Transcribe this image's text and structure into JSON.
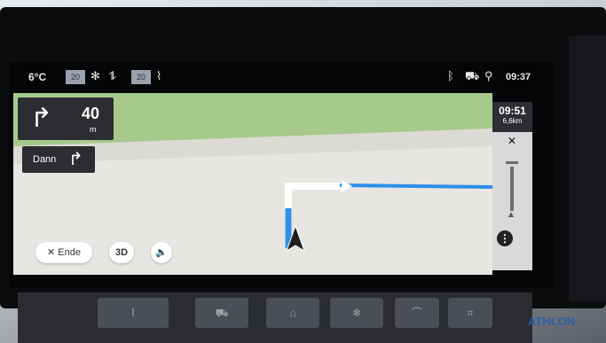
{
  "status_bar": {
    "outside_temp": "6°C",
    "left_temp_setting": "20",
    "right_temp_setting": "20",
    "clock": "09:37",
    "icons": [
      "fan-icon",
      "seat-airflow-icon",
      "seat-heat-icon",
      "bluetooth-icon",
      "car-icon",
      "signal-icon"
    ]
  },
  "navigation": {
    "next_turn": {
      "direction": "right",
      "distance": "40",
      "unit": "m"
    },
    "then_turn": {
      "label": "Dann",
      "direction": "right"
    },
    "eta": {
      "arrival_time": "09:51",
      "remaining_distance": "6,6km"
    },
    "buttons": {
      "end_label": "Ende",
      "view_label": "3D"
    }
  },
  "colors": {
    "route": "#2d8fe8",
    "map_park": "#a7c98b",
    "map_ground": "#e7e6e3"
  },
  "logo": {
    "brand": "ATHLON"
  }
}
